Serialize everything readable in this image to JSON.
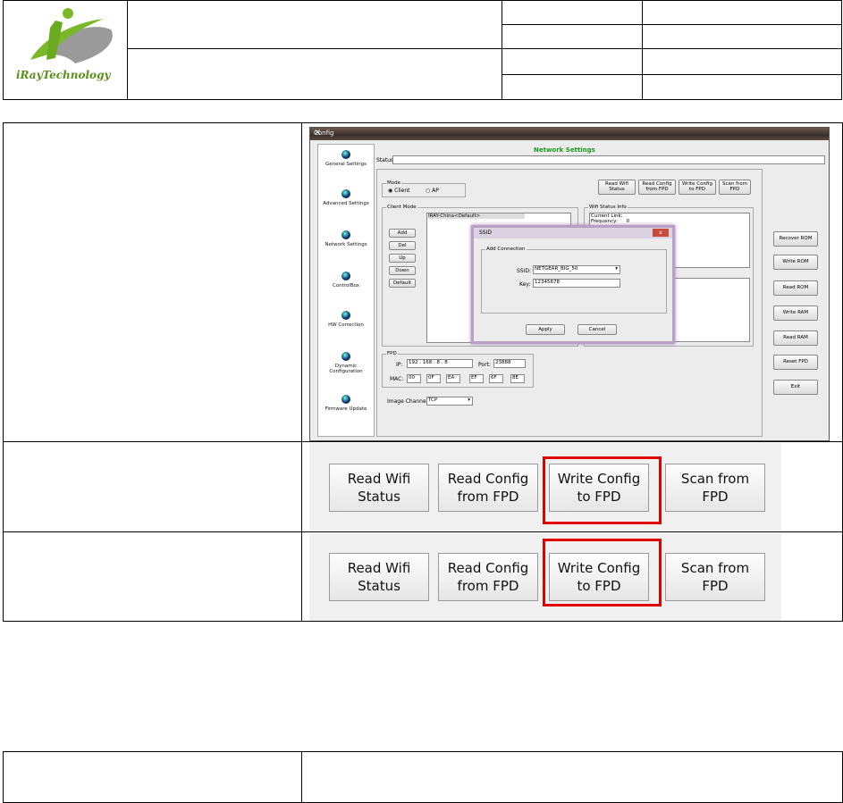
{
  "logo": {
    "brand": "iRayTechnology",
    "i_mark": "i",
    "ray": "Ray",
    "tech": "Technology"
  },
  "window": {
    "title": "Config",
    "close": "×",
    "heading": "Network Settings",
    "status_label": "Status:",
    "nav": [
      {
        "label": "General Settings",
        "icon": "gear-icon"
      },
      {
        "label": "Advanced Settings",
        "icon": "gear-icon"
      },
      {
        "label": "Network Settings",
        "icon": "gear-icon"
      },
      {
        "label": "ControlBox",
        "icon": "gear-icon"
      },
      {
        "label": "HW Correction",
        "icon": "gear-icon"
      },
      {
        "label": "Dynamic Configuration",
        "icon": "gear-icon"
      },
      {
        "label": "Firmware Update",
        "icon": "gear-icon"
      }
    ],
    "mode": {
      "title": "Mode",
      "client": "Client",
      "ap": "AP"
    },
    "top_buttons": [
      "Read Wifi Status",
      "Read Config from FPD",
      "Write Config to FPD",
      "Scan from FPD"
    ],
    "client_mode": {
      "title": "Client Mode",
      "entry": "IRAY-China<Default>",
      "buttons": [
        "Add",
        "Del",
        "Up",
        "Down",
        "Default"
      ]
    },
    "wifi_status": {
      "title": "Wifi Status Info",
      "line1": "Current Link:",
      "line2": "Frequency:",
      "freq_value": "0"
    },
    "right_buttons": [
      "Recover ROM",
      "Write ROM",
      "Read ROM",
      "Write RAM",
      "Read RAM",
      "Reset FPD",
      "Exit"
    ],
    "fpd": {
      "title": "FPD",
      "ip_label": "IP:",
      "ip": [
        "192",
        "168",
        "8",
        "8"
      ],
      "port_label": "Port:",
      "port": "23888",
      "mac_label": "MAC:",
      "mac": [
        "00",
        "0F",
        "EA",
        "EF",
        "6F",
        "8E"
      ]
    },
    "image_channel": {
      "label": "Image Channel:",
      "value": "TCP"
    },
    "dialog": {
      "title": "SSID",
      "group": "Add Connection",
      "ssid_label": "SSID:",
      "ssid_value": "NETGEAR_BIG_50",
      "key_label": "Key:",
      "key_value": "12345678",
      "apply": "Apply",
      "cancel": "Cancel"
    }
  },
  "big_buttons_row1": [
    "Read Wifi\nStatus",
    "Read Config\nfrom FPD",
    "Write Config\nto FPD",
    "Scan from\nFPD"
  ],
  "big_buttons_row2": [
    "Read Wifi\nStatus",
    "Read Config\nfrom FPD",
    "Write Config\nto FPD",
    "Scan from\nFPD"
  ],
  "colors": {
    "highlight": "#e00000",
    "heading_green": "#1a9a1a",
    "logo_green": "#7ab829"
  }
}
